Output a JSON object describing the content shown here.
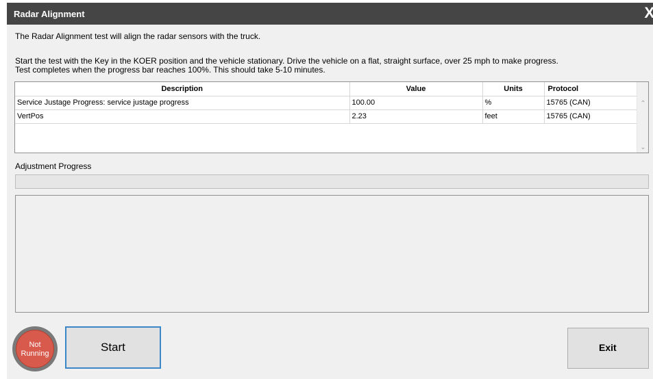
{
  "window": {
    "title": "Radar Alignment",
    "close_glyph": "X"
  },
  "intro_text": "The Radar Alignment test will align the radar sensors with the truck.",
  "instructions": [
    "Start the test with the Key in the KOER position and the vehicle stationary. Drive the vehicle on a flat, straight surface, over 25 mph to make progress.",
    "Test completes when the progress bar reaches 100%. This should take 5-10 minutes."
  ],
  "grid": {
    "columns": [
      "Description",
      "Value",
      "Units",
      "Protocol"
    ],
    "rows": [
      [
        "Service Justage Progress: service justage progress",
        "100.00",
        "%",
        "15765 (CAN)"
      ],
      [
        "VertPos",
        "2.23",
        "feet",
        "15765 (CAN)"
      ]
    ]
  },
  "adjustment": {
    "label": "Adjustment Progress",
    "progress": 0
  },
  "status": {
    "line1": "Not",
    "line2": "Running",
    "color": "#d85a4c"
  },
  "buttons": {
    "start_label": "Start",
    "exit_label": "Exit"
  },
  "icons": {
    "close": "close-icon",
    "scroll_up": "chevron-up-icon",
    "scroll_down": "chevron-down-icon"
  }
}
